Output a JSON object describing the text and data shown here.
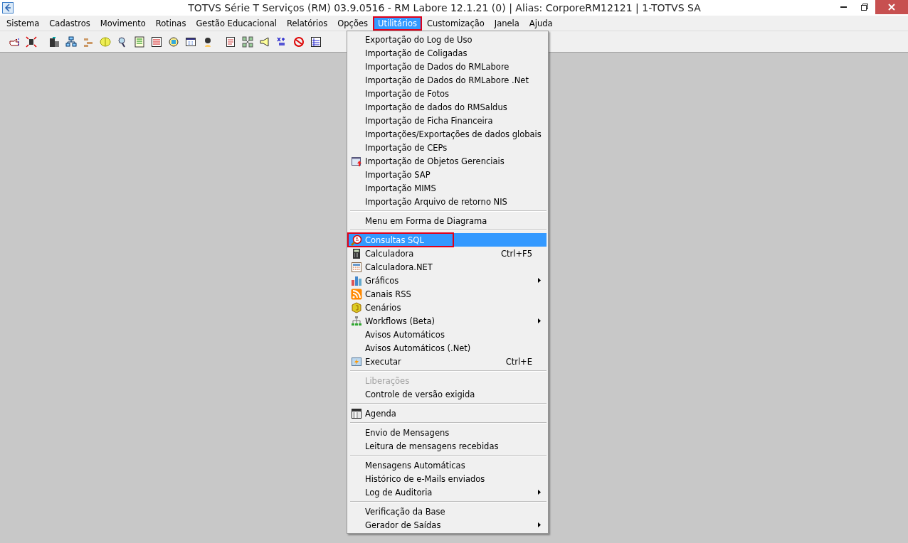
{
  "window": {
    "title": "TOTVS Série T Serviços (RM) 03.9.0516 - RM Labore 12.1.21 (0) | Alias: CorporeRM12121 | 1-TOTVS SA"
  },
  "menu_bar": [
    {
      "label": "Sistema",
      "selected": false,
      "highlighted": false
    },
    {
      "label": "Cadastros",
      "selected": false,
      "highlighted": false
    },
    {
      "label": "Movimento",
      "selected": false,
      "highlighted": false
    },
    {
      "label": "Rotinas",
      "selected": false,
      "highlighted": false
    },
    {
      "label": "Gestão Educacional",
      "selected": false,
      "highlighted": false
    },
    {
      "label": "Relatórios",
      "selected": false,
      "highlighted": false
    },
    {
      "label": "Opções",
      "selected": false,
      "highlighted": false
    },
    {
      "label": "Utilitários",
      "selected": true,
      "highlighted": true
    },
    {
      "label": "Customização",
      "selected": false,
      "highlighted": false
    },
    {
      "label": "Janela",
      "selected": false,
      "highlighted": false
    },
    {
      "label": "Ajuda",
      "selected": false,
      "highlighted": false
    }
  ],
  "dropdown_menu": [
    {
      "kind": "item",
      "label": "Exportação do Log de Uso",
      "selected": false,
      "disabled": false
    },
    {
      "kind": "item",
      "label": "Importação de Coligadas",
      "selected": false,
      "disabled": false
    },
    {
      "kind": "item",
      "label": "Importação de Dados do RMLabore",
      "selected": false,
      "disabled": false
    },
    {
      "kind": "item",
      "label": "Importação de Dados do RMLabore .Net",
      "selected": false,
      "disabled": false
    },
    {
      "kind": "item",
      "label": "Importação de Fotos",
      "selected": false,
      "disabled": false
    },
    {
      "kind": "item",
      "label": "Importação de dados do RMSaldus",
      "selected": false,
      "disabled": false
    },
    {
      "kind": "item",
      "label": "Importação de Ficha Financeira",
      "selected": false,
      "disabled": false
    },
    {
      "kind": "item",
      "label": "Importações/Exportações de dados globais",
      "selected": false,
      "disabled": false
    },
    {
      "kind": "item",
      "label": "Importação de CEPs",
      "selected": false,
      "disabled": false
    },
    {
      "kind": "item",
      "label": "Importação de Objetos Gerenciais",
      "selected": false,
      "disabled": false
    },
    {
      "kind": "item",
      "label": "Importação SAP",
      "selected": false,
      "disabled": false
    },
    {
      "kind": "item",
      "label": "Importação MIMS",
      "selected": false,
      "disabled": false
    },
    {
      "kind": "item",
      "label": "Importação Arquivo de retorno NIS",
      "selected": false,
      "disabled": false
    },
    {
      "kind": "separator"
    },
    {
      "kind": "item",
      "label": "Menu em Forma de Diagrama",
      "selected": false,
      "disabled": false
    },
    {
      "kind": "separator"
    },
    {
      "kind": "item",
      "label": "Consultas SQL",
      "selected": true,
      "highlighted": true,
      "disabled": false
    },
    {
      "kind": "item",
      "label": "Calculadora",
      "shortcut": "Ctrl+F5",
      "selected": false,
      "disabled": false
    },
    {
      "kind": "item",
      "label": "Calculadora.NET",
      "selected": false,
      "disabled": false
    },
    {
      "kind": "item",
      "label": "Gráficos",
      "submenu": true,
      "selected": false,
      "disabled": false
    },
    {
      "kind": "item",
      "label": "Canais RSS",
      "selected": false,
      "disabled": false
    },
    {
      "kind": "item",
      "label": "Cenários",
      "selected": false,
      "disabled": false
    },
    {
      "kind": "item",
      "label": "Workflows (Beta)",
      "submenu": true,
      "selected": false,
      "disabled": false
    },
    {
      "kind": "item",
      "label": "Avisos Automáticos",
      "selected": false,
      "disabled": false
    },
    {
      "kind": "item",
      "label": "Avisos Automáticos (.Net)",
      "selected": false,
      "disabled": false
    },
    {
      "kind": "item",
      "label": "Executar",
      "shortcut": "Ctrl+E",
      "selected": false,
      "disabled": false
    },
    {
      "kind": "separator"
    },
    {
      "kind": "item",
      "label": "Liberações",
      "selected": false,
      "disabled": true
    },
    {
      "kind": "item",
      "label": "Controle de versão exigida",
      "selected": false,
      "disabled": false
    },
    {
      "kind": "separator"
    },
    {
      "kind": "item",
      "label": "Agenda",
      "selected": false,
      "disabled": false
    },
    {
      "kind": "separator"
    },
    {
      "kind": "item",
      "label": "Envio de Mensagens",
      "selected": false,
      "disabled": false
    },
    {
      "kind": "item",
      "label": "Leitura de mensagens recebidas",
      "selected": false,
      "disabled": false
    },
    {
      "kind": "separator"
    },
    {
      "kind": "item",
      "label": "Mensagens Automáticas",
      "selected": false,
      "disabled": false
    },
    {
      "kind": "item",
      "label": "Histórico de e-Mails enviados",
      "selected": false,
      "disabled": false
    },
    {
      "kind": "item",
      "label": "Log de Auditoria",
      "submenu": true,
      "selected": false,
      "disabled": false
    },
    {
      "kind": "separator"
    },
    {
      "kind": "item",
      "label": "Verificação da Base",
      "selected": false,
      "disabled": false
    },
    {
      "kind": "item",
      "label": "Gerador de Saídas",
      "submenu": true,
      "selected": false,
      "disabled": false
    }
  ]
}
